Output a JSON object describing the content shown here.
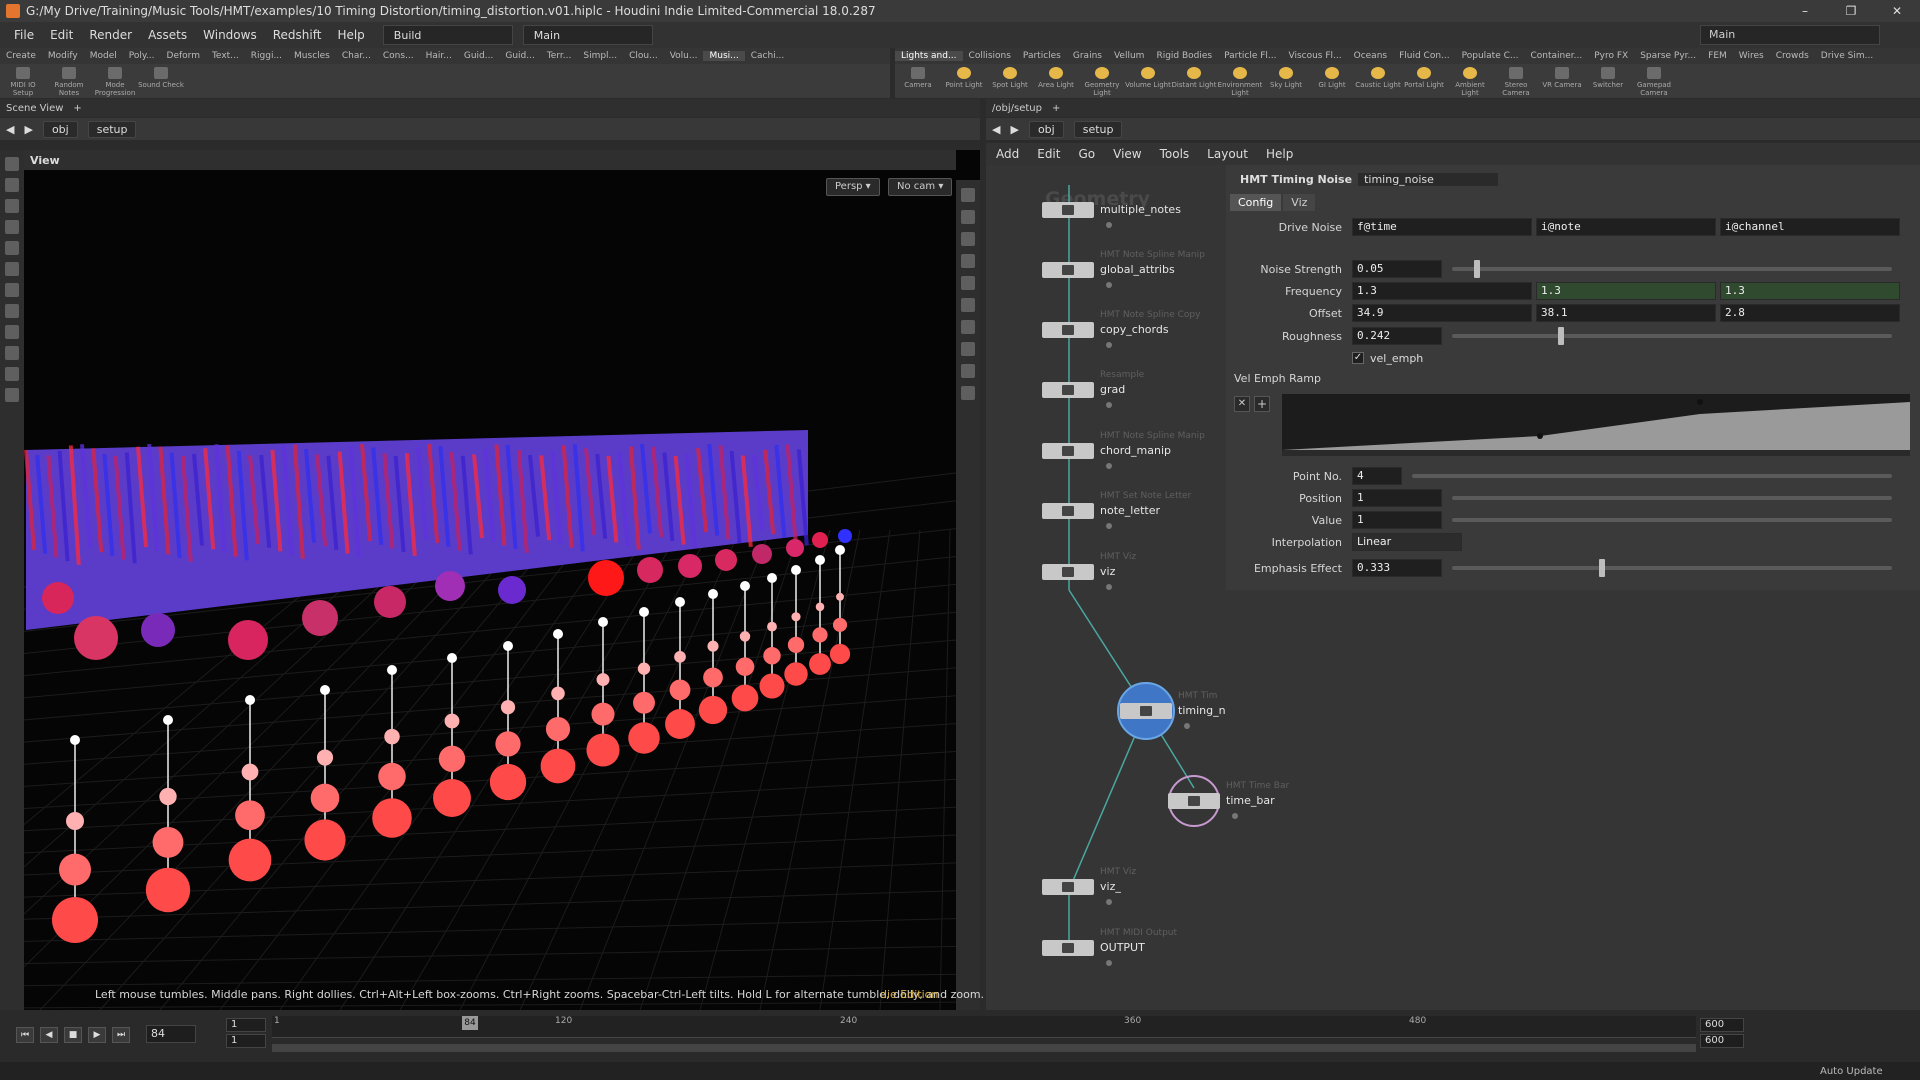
{
  "window": {
    "title": "G:/My Drive/Training/Music Tools/HMT/examples/10 Timing Distortion/timing_distortion.v01.hiplc - Houdini Indie Limited-Commercial 18.0.287"
  },
  "menu": {
    "items": [
      "File",
      "Edit",
      "Render",
      "Assets",
      "Windows",
      "Redshift",
      "Help"
    ],
    "desktop": "Build",
    "desktop2": "Main",
    "right": "Main"
  },
  "shelf_left": {
    "tabs": [
      "Create",
      "Modify",
      "Model",
      "Poly...",
      "Deform",
      "Text...",
      "Riggi...",
      "Muscles",
      "Char...",
      "Cons...",
      "Hair...",
      "Guid...",
      "Guid...",
      "Terr...",
      "Simpl...",
      "Clou...",
      "Volu...",
      "Musi...",
      "Cachi..."
    ],
    "tools": [
      "MIDI IO Setup",
      "Random Notes",
      "Mode Progression",
      "Sound Check"
    ]
  },
  "shelf_right": {
    "tabs": [
      "Lights and...",
      "Collisions",
      "Particles",
      "Grains",
      "Vellum",
      "Rigid Bodies",
      "Particle Fl...",
      "Viscous Fl...",
      "Oceans",
      "Fluid Con...",
      "Populate C...",
      "Container...",
      "Pyro FX",
      "Sparse Pyr...",
      "FEM",
      "Wires",
      "Crowds",
      "Drive Sim..."
    ],
    "tools": [
      "Camera",
      "Point Light",
      "Spot Light",
      "Area Light",
      "Geometry Light",
      "Volume Light",
      "Distant Light",
      "Environment Light",
      "Sky Light",
      "GI Light",
      "Caustic Light",
      "Portal Light",
      "Ambient Light",
      "Stereo Camera",
      "VR Camera",
      "Switcher",
      "Gamepad Camera"
    ]
  },
  "left_pane": {
    "tab": "Scene View",
    "path_obj": "obj",
    "path_node": "setup",
    "view_title": "View",
    "persp": "Persp ▾",
    "cam": "No cam ▾",
    "hint": "Left mouse tumbles. Middle pans. Right dollies. Ctrl+Alt+Left box-zooms. Ctrl+Right zooms. Spacebar-Ctrl-Left tilts. Hold L for alternate tumble, dolly, and zoom.",
    "edition": "die Edition"
  },
  "right_pane": {
    "tab": "/obj/setup",
    "path_obj": "obj",
    "path_node": "setup",
    "menu": [
      "Add",
      "Edit",
      "Go",
      "View",
      "Tools",
      "Layout",
      "Help"
    ],
    "watermark": "Geometry"
  },
  "nodes": [
    {
      "type": "",
      "name": "multiple_notes"
    },
    {
      "type": "HMT Note Spline Manip",
      "name": "global_attribs"
    },
    {
      "type": "HMT Note Spline Copy",
      "name": "copy_chords"
    },
    {
      "type": "Resample",
      "name": "grad"
    },
    {
      "type": "HMT Note Spline Manip",
      "name": "chord_manip"
    },
    {
      "type": "HMT Set Note Letter",
      "name": "note_letter"
    },
    {
      "type": "HMT Viz",
      "name": "viz"
    },
    {
      "type": "HMT Tim",
      "name": "timing_n"
    },
    {
      "type": "HMT Time Bar",
      "name": "time_bar"
    },
    {
      "type": "HMT Viz",
      "name": "viz_"
    },
    {
      "type": "HMT MIDI Output",
      "name": "OUTPUT"
    }
  ],
  "params": {
    "node_type": "HMT Timing Noise",
    "node_name": "timing_noise",
    "tabs": [
      "Config",
      "Viz"
    ],
    "drive_noise": {
      "label": "Drive Noise",
      "v": [
        "f@time",
        "i@note",
        "i@channel"
      ]
    },
    "noise_strength": {
      "label": "Noise Strength",
      "v": "0.05",
      "level": 0.05
    },
    "frequency": {
      "label": "Frequency",
      "v": [
        "1.3",
        "1.3",
        "1.3"
      ]
    },
    "offset": {
      "label": "Offset",
      "v": [
        "34.9",
        "38.1",
        "2.8"
      ]
    },
    "roughness": {
      "label": "Roughness",
      "v": "0.242",
      "level": 0.242
    },
    "vel_emph": {
      "label": "vel_emph",
      "checked": true
    },
    "ramp_label": "Vel Emph Ramp",
    "point_no": {
      "label": "Point No.",
      "v": "4"
    },
    "position": {
      "label": "Position",
      "v": "1"
    },
    "value": {
      "label": "Value",
      "v": "1"
    },
    "interpolation": {
      "label": "Interpolation",
      "v": "Linear"
    },
    "emphasis": {
      "label": "Emphasis Effect",
      "v": "0.333",
      "level": 0.333
    }
  },
  "timeline": {
    "frame": "84",
    "start": "1",
    "start2": "1",
    "end": "600",
    "end2": "600",
    "ticks": [
      "1",
      "120",
      "240",
      "360",
      "480"
    ],
    "cursor": "84"
  },
  "status": {
    "auto_update": "Auto Update"
  }
}
